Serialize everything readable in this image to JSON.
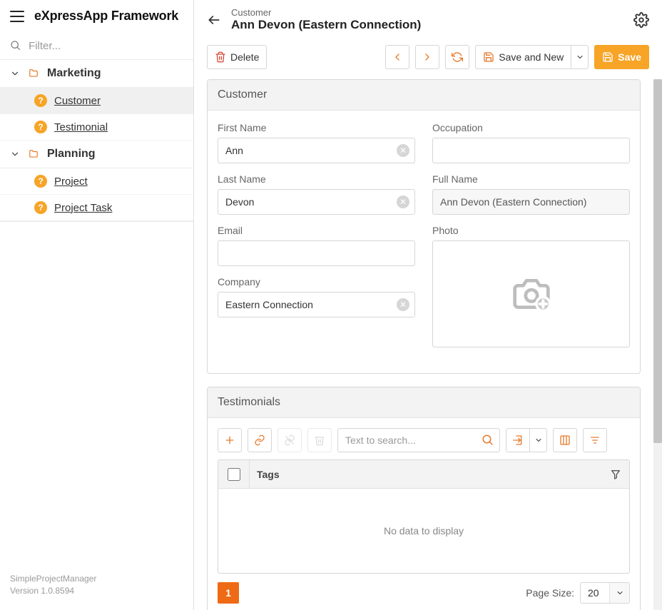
{
  "brand": "eXpressApp Framework",
  "filter": {
    "placeholder": "Filter..."
  },
  "nav": {
    "groups": [
      {
        "label": "Marketing",
        "items": [
          "Customer",
          "Testimonial"
        ],
        "activeIndex": 0
      },
      {
        "label": "Planning",
        "items": [
          "Project",
          "Project Task"
        ],
        "activeIndex": -1
      }
    ]
  },
  "footer": {
    "app": "SimpleProjectManager",
    "version": "Version 1.0.8594"
  },
  "header": {
    "breadcrumb": "Customer",
    "title": "Ann Devon (Eastern Connection)"
  },
  "toolbar": {
    "delete": "Delete",
    "saveAndNew": "Save and New",
    "save": "Save"
  },
  "customer": {
    "panelTitle": "Customer",
    "labels": {
      "firstName": "First Name",
      "lastName": "Last Name",
      "email": "Email",
      "company": "Company",
      "occupation": "Occupation",
      "fullName": "Full Name",
      "photo": "Photo"
    },
    "values": {
      "firstName": "Ann",
      "lastName": "Devon",
      "email": "",
      "company": "Eastern Connection",
      "occupation": "",
      "fullName": "Ann Devon (Eastern Connection)"
    }
  },
  "testimonials": {
    "panelTitle": "Testimonials",
    "searchPlaceholder": "Text to search...",
    "tagsHeader": "Tags",
    "noData": "No data to display",
    "page": "1",
    "pageSizeLabel": "Page Size:",
    "pageSize": "20"
  }
}
